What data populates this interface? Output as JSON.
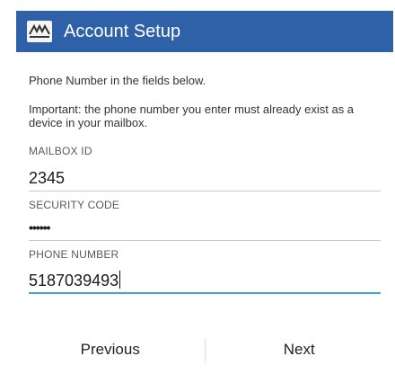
{
  "header": {
    "title": "Account Setup",
    "logo_icon": "att-globe-icon",
    "background_color": "#2f61a8"
  },
  "intro": {
    "line1": "Phone Number in the fields below.",
    "important": "Important: the phone number you enter must already exist as a device in your mailbox."
  },
  "fields": {
    "mailbox_id": {
      "label": "MAILBOX ID",
      "value": "2345"
    },
    "security_code": {
      "label": "SECURITY CODE",
      "value": "••••••"
    },
    "phone_number": {
      "label": "PHONE NUMBER",
      "value": "5187039493"
    }
  },
  "footer": {
    "previous_label": "Previous",
    "next_label": "Next"
  },
  "accent_colors": {
    "active_underline": "#35a8d6"
  }
}
